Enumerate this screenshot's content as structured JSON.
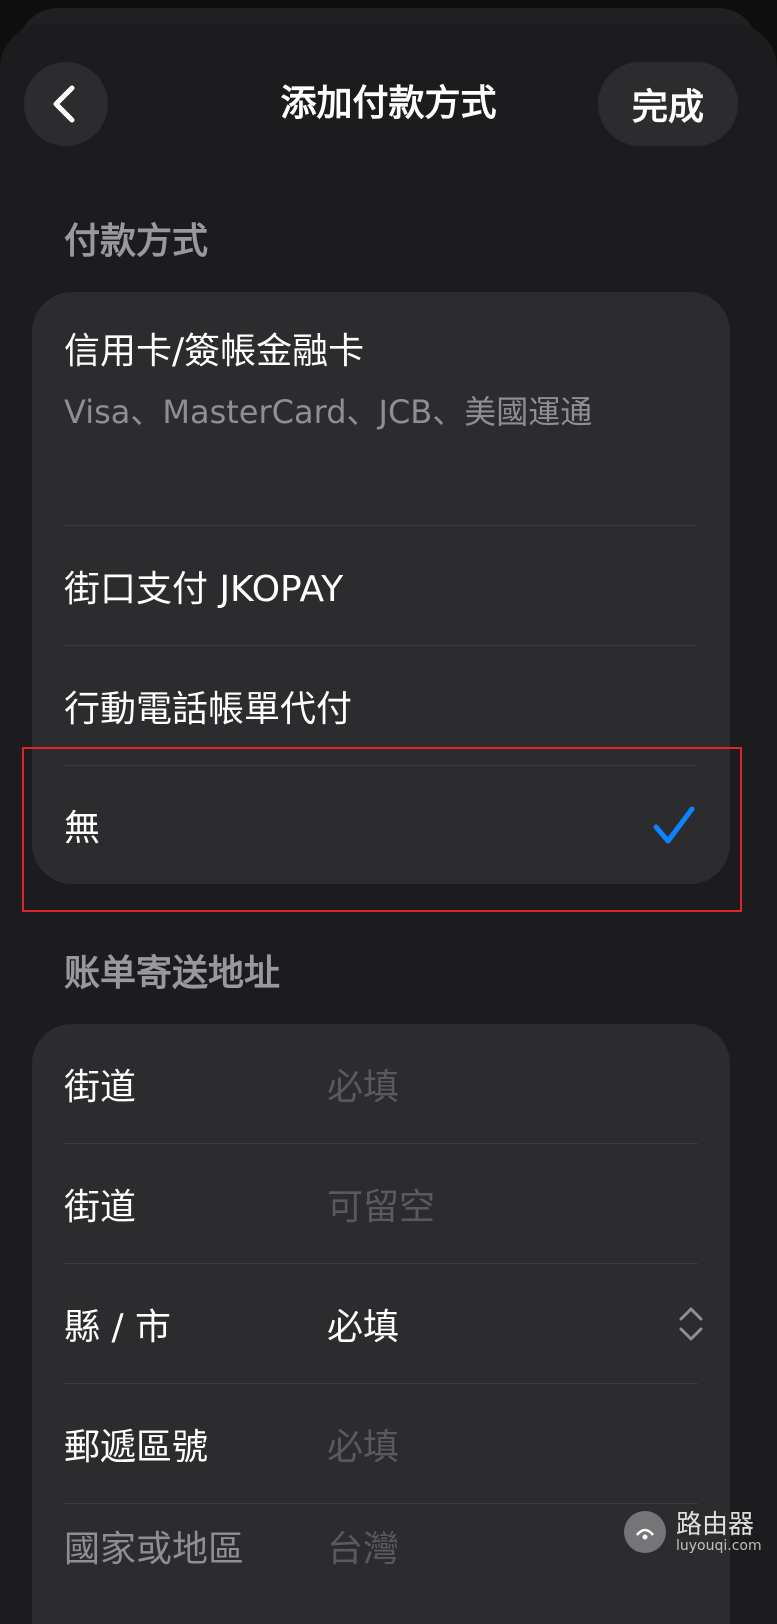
{
  "header": {
    "title": "添加付款方式",
    "done_label": "完成"
  },
  "payment": {
    "section_title": "付款方式",
    "credit_card": {
      "label": "信用卡/簽帳金融卡",
      "detail": "Visa、MasterCard、JCB、美國運通"
    },
    "jkopay_label": "街口支付 JKOPAY",
    "carrier_billing_label": "行動電話帳單代付",
    "none_label": "無",
    "selected": "無"
  },
  "billing": {
    "section_title": "账单寄送地址",
    "fields": [
      {
        "label": "街道",
        "value": "必填",
        "is_placeholder": true
      },
      {
        "label": "街道",
        "value": "可留空",
        "is_placeholder": true
      },
      {
        "label": "縣 / 市",
        "value": "必填",
        "is_placeholder": false
      },
      {
        "label": "郵遞區號",
        "value": "必填",
        "is_placeholder": true
      },
      {
        "label": "國家或地區",
        "value": "台灣",
        "is_placeholder": true
      }
    ]
  },
  "watermark": {
    "main": "路由器",
    "sub": "luyouqi.com"
  },
  "colors": {
    "accent": "#0a84ff",
    "highlight": "#e0242b"
  },
  "icons": {
    "back": "chevron-left-icon",
    "check": "checkmark-icon",
    "picker": "chevron-up-down-icon"
  }
}
